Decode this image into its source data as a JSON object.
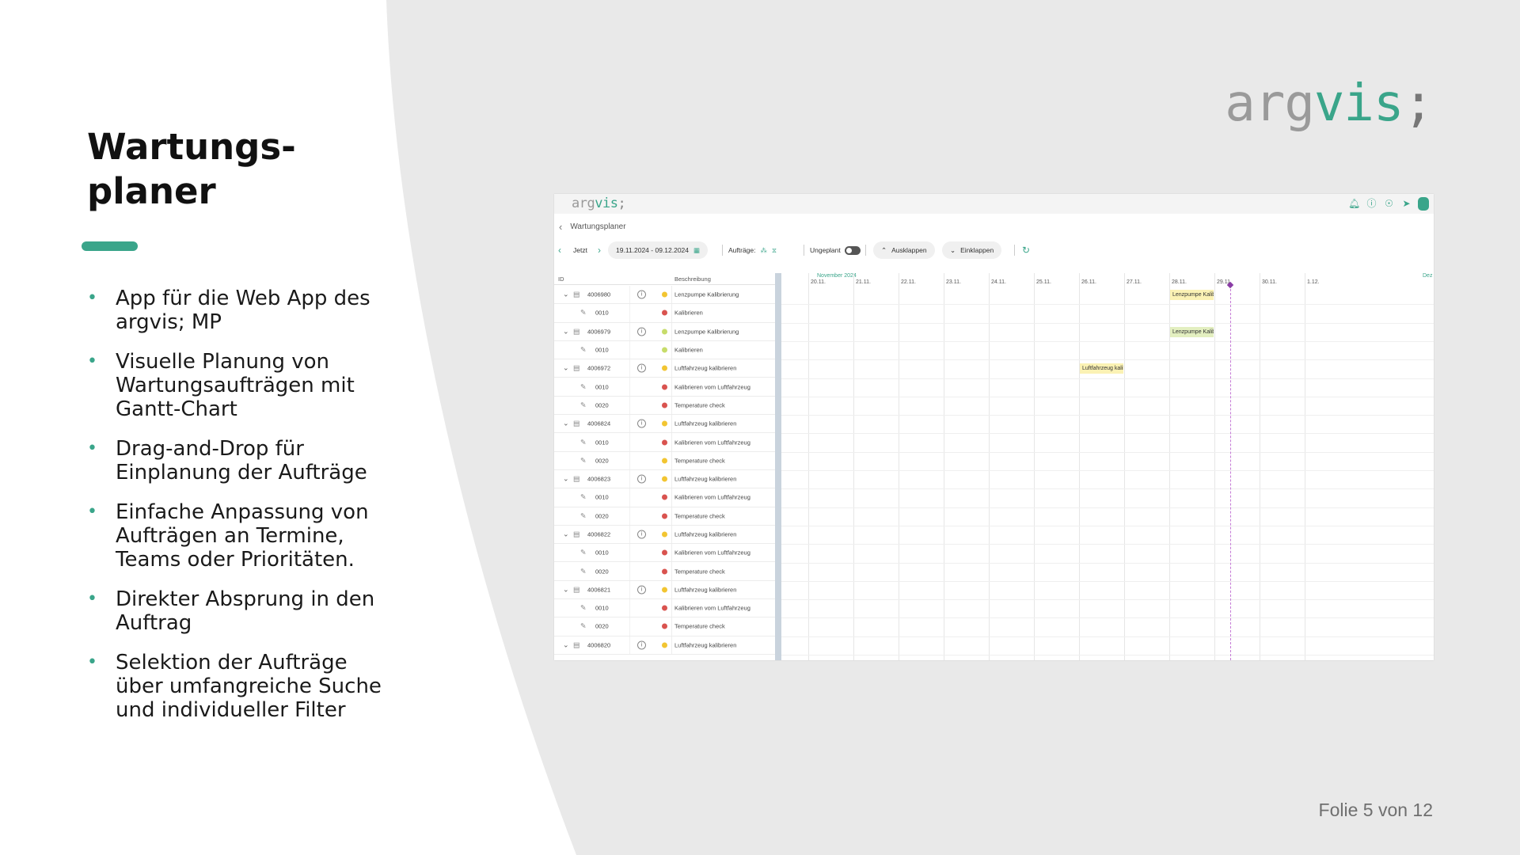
{
  "slide": {
    "title": "Wartungs-\nplaner",
    "bullets": [
      "App für die Web App des argvis; MP",
      "Visuelle Planung von Wartungsaufträgen mit Gantt-Chart",
      "Drag-and-Drop für Einplanung der Aufträge",
      "Einfache Anpassung von Aufträgen an Termine, Teams oder Prioritäten.",
      "Direkter Absprung in den Auftrag",
      "Selektion der Aufträge über umfangreiche Suche und individueller Filter"
    ],
    "logo": {
      "part1": "arg",
      "part2": "vis",
      "part3": ";"
    },
    "footer": "Folie 5 von 12",
    "accent_color": "#3aa58a"
  },
  "app": {
    "logo": {
      "part1": "arg",
      "part2": "vis",
      "part3": ";"
    },
    "breadcrumb": "Wartungsplaner",
    "toolbar": {
      "now_label": "Jetzt",
      "date_range": "19.11.2024 - 09.12.2024",
      "orders_label": "Aufträge:",
      "unplanned_label": "Ungeplant",
      "expand_label": "Ausklappen",
      "collapse_label": "Einklappen"
    },
    "grid": {
      "col_id": "ID",
      "col_desc": "Beschreibung",
      "rows": [
        {
          "id": "4006980",
          "desc": "Lenzpumpe Kalibrierung",
          "status": "#f2c531",
          "child": false
        },
        {
          "id": "0010",
          "desc": "Kalibrieren",
          "status": "#d9534f",
          "child": true
        },
        {
          "id": "4006979",
          "desc": "Lenzpumpe Kalibrierung",
          "status": "#c7dc6a",
          "child": false
        },
        {
          "id": "0010",
          "desc": "Kalibrieren",
          "status": "#c7dc6a",
          "child": true
        },
        {
          "id": "4006972",
          "desc": "Luftfahrzeug kalibrieren",
          "status": "#f2c531",
          "child": false
        },
        {
          "id": "0010",
          "desc": "Kalibrieren vom Luftfahrzeug",
          "status": "#d9534f",
          "child": true
        },
        {
          "id": "0020",
          "desc": "Temperature check",
          "status": "#d9534f",
          "child": true
        },
        {
          "id": "4006824",
          "desc": "Luftfahrzeug kalibrieren",
          "status": "#f2c531",
          "child": false
        },
        {
          "id": "0010",
          "desc": "Kalibrieren vom Luftfahrzeug",
          "status": "#d9534f",
          "child": true
        },
        {
          "id": "0020",
          "desc": "Temperature check",
          "status": "#f2c531",
          "child": true
        },
        {
          "id": "4006823",
          "desc": "Luftfahrzeug kalibrieren",
          "status": "#f2c531",
          "child": false
        },
        {
          "id": "0010",
          "desc": "Kalibrieren vom Luftfahrzeug",
          "status": "#d9534f",
          "child": true
        },
        {
          "id": "0020",
          "desc": "Temperature check",
          "status": "#d9534f",
          "child": true
        },
        {
          "id": "4006822",
          "desc": "Luftfahrzeug kalibrieren",
          "status": "#f2c531",
          "child": false
        },
        {
          "id": "0010",
          "desc": "Kalibrieren vom Luftfahrzeug",
          "status": "#d9534f",
          "child": true
        },
        {
          "id": "0020",
          "desc": "Temperature check",
          "status": "#d9534f",
          "child": true
        },
        {
          "id": "4006821",
          "desc": "Luftfahrzeug kalibrieren",
          "status": "#f2c531",
          "child": false
        },
        {
          "id": "0010",
          "desc": "Kalibrieren vom Luftfahrzeug",
          "status": "#d9534f",
          "child": true
        },
        {
          "id": "0020",
          "desc": "Temperature check",
          "status": "#d9534f",
          "child": true
        },
        {
          "id": "4006820",
          "desc": "Luftfahrzeug kalibrieren",
          "status": "#f2c531",
          "child": false
        }
      ]
    },
    "timeline": {
      "month": "November 2024",
      "next_month": "Dez",
      "days": [
        "20.11.",
        "21.11.",
        "22.11.",
        "23.11.",
        "24.11.",
        "25.11.",
        "26.11.",
        "27.11.",
        "28.11.",
        "29.11.",
        "30.11.",
        "1.12."
      ],
      "today": "29.11.",
      "bars": [
        {
          "label": "Lenzpumpe Kalib...",
          "row": 0,
          "day": "28.11.",
          "color": "#fbf2b4"
        },
        {
          "label": "Lenzpumpe Kalib...",
          "row": 2,
          "day": "28.11.",
          "color": "#e3efc0"
        },
        {
          "label": "Luftfahrzeug kalib...",
          "row": 4,
          "day": "26.11.",
          "color": "#fbf2b4"
        }
      ]
    }
  }
}
